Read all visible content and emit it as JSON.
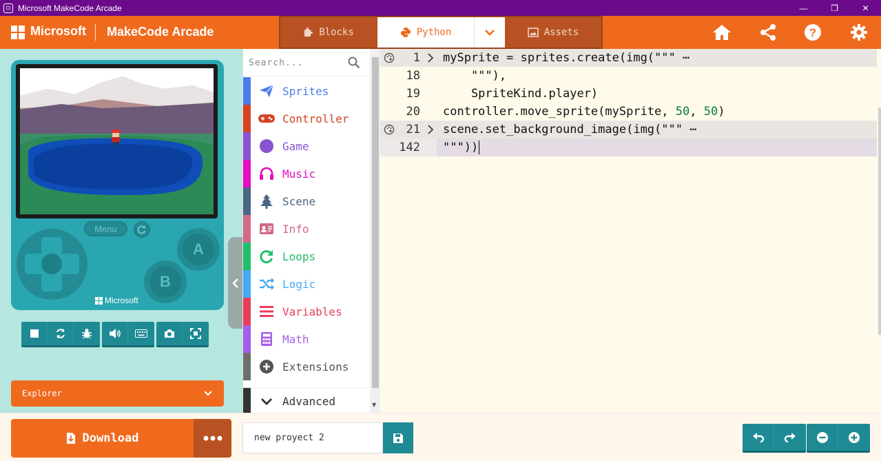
{
  "window": {
    "title": "Microsoft MakeCode Arcade",
    "controls": [
      "—",
      "❐",
      "✕"
    ]
  },
  "header": {
    "brand": "Microsoft",
    "app_name": "MakeCode Arcade",
    "tabs": {
      "blocks": "Blocks",
      "python": "Python",
      "assets": "Assets"
    },
    "active_tab": "Python",
    "accent_color": "#f06a1e"
  },
  "simulator": {
    "menu_label": "Menu",
    "a_label": "A",
    "b_label": "B",
    "brand": "Microsoft",
    "toolbar_icons": [
      "stop-icon",
      "restart-icon",
      "debug-icon",
      "mute-icon",
      "keyboard-icon",
      "screenshot-icon",
      "fullscreen-icon"
    ]
  },
  "explorer": {
    "label": "Explorer"
  },
  "toolbox": {
    "search_placeholder": "Search...",
    "categories": [
      {
        "label": "Sprites",
        "color": "#4b7bec"
      },
      {
        "label": "Controller",
        "color": "#d54322"
      },
      {
        "label": "Game",
        "color": "#8854d0"
      },
      {
        "label": "Music",
        "color": "#e30fc0"
      },
      {
        "label": "Scene",
        "color": "#4b6584"
      },
      {
        "label": "Info",
        "color": "#cf6a87"
      },
      {
        "label": "Loops",
        "color": "#20bf6b"
      },
      {
        "label": "Logic",
        "color": "#45aaf2"
      },
      {
        "label": "Variables",
        "color": "#e93d5c"
      },
      {
        "label": "Math",
        "color": "#a55eea"
      },
      {
        "label": "Extensions",
        "color": "#6e6e6e"
      },
      {
        "label": "Advanced",
        "color": "#333333"
      }
    ]
  },
  "code": {
    "lines": [
      {
        "num": "1",
        "text": "mySprite = sprites.create(img(\"\"\" ⋯"
      },
      {
        "num": "18",
        "text": "    \"\"\"),"
      },
      {
        "num": "19",
        "text": "    SpriteKind.player)"
      },
      {
        "num": "20",
        "pre": "controller.move_sprite(mySprite, ",
        "n1": "50",
        "mid": ", ",
        "n2": "50",
        "post": ")"
      },
      {
        "num": "21",
        "text": "scene.set_background_image(img(\"\"\" ⋯"
      },
      {
        "num": "142",
        "text": "\"\"\"))"
      }
    ]
  },
  "bottom": {
    "download_label": "Download",
    "project_name": "new proyect 2"
  }
}
